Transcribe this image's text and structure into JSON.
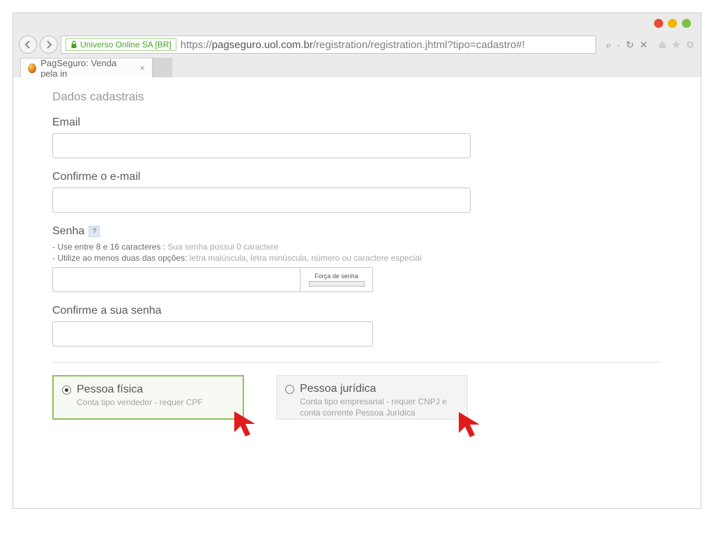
{
  "browser": {
    "ssl_issuer": "Universo Online SA [BR]",
    "url_prefix": "https://",
    "url_host": "pagseguro.uol.com.br",
    "url_path": "/registration/registration.jhtml?tipo=cadastro#!",
    "tab_title": "PagSeguro: Venda pela in",
    "search_symbol": "⌕",
    "refresh_symbol": "↻",
    "close_symbol": "✕"
  },
  "form": {
    "section_title": "Dados cadastrais",
    "email_label": "Email",
    "confirm_email_label": "Confirme o e-mail",
    "password_label": "Senha",
    "help_symbol": "?",
    "hint1_prefix": "- Use entre 8 e 16 caracteres : ",
    "hint1_muted": "Sua senha possui 0 caractere",
    "hint2_prefix": "- Utilize ao menos duas das opções: ",
    "hint2_muted": "letra maiúscula, letra minúscula, número ou caractere especial",
    "strength_label": "Força de senha",
    "confirm_password_label": "Confirme a sua senha"
  },
  "account_type": {
    "pf_title": "Pessoa física",
    "pf_desc": "Conta tipo vendedor - requer CPF",
    "pj_title": "Pessoa jurídica",
    "pj_desc": "Conta tipo empresarial - requer CNPJ e conta corrente Pessoa Jurídica"
  }
}
